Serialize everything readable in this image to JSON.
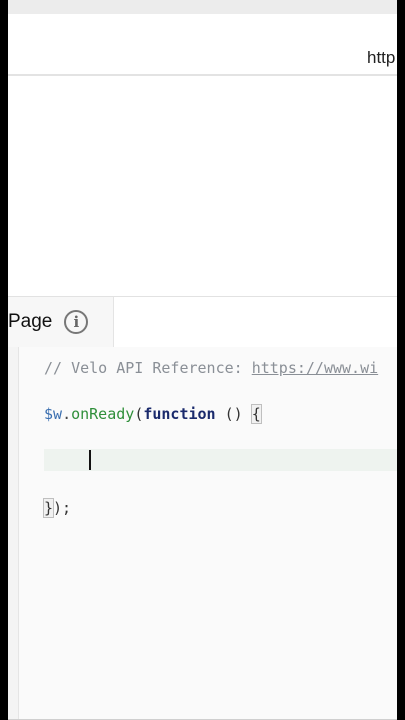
{
  "browser": {
    "url_text": "http"
  },
  "panel": {
    "tab_label": "Page",
    "info_icon": "info-icon",
    "info_glyph": "i"
  },
  "editor": {
    "line1": {
      "comment": "// Velo API Reference: ",
      "link": "https://www.wi"
    },
    "line2": {
      "dollar": "$w",
      "dot": ".",
      "method": "onReady",
      "open": "(",
      "keyword": "function",
      "params": " () ",
      "brace_open": "{"
    },
    "line4": {
      "brace_close": "}",
      "tail": ");"
    }
  },
  "colors": {
    "comment": "#8a8f96",
    "method": "#2f8f3a",
    "keyword": "#1a2a6c",
    "dollar": "#3b6fb0"
  }
}
